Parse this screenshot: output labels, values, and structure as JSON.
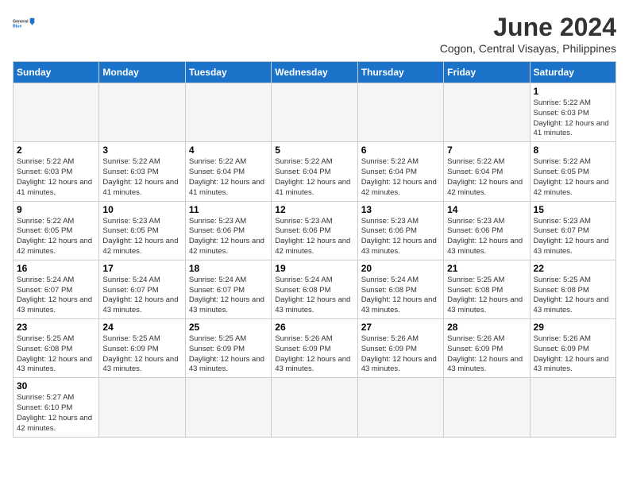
{
  "logo": {
    "text_general": "General",
    "text_blue": "Blue"
  },
  "header": {
    "month": "June 2024",
    "location": "Cogon, Central Visayas, Philippines"
  },
  "weekdays": [
    "Sunday",
    "Monday",
    "Tuesday",
    "Wednesday",
    "Thursday",
    "Friday",
    "Saturday"
  ],
  "days": [
    {
      "date": "",
      "sunrise": "",
      "sunset": "",
      "daylight": ""
    },
    {
      "date": "",
      "sunrise": "",
      "sunset": "",
      "daylight": ""
    },
    {
      "date": "",
      "sunrise": "",
      "sunset": "",
      "daylight": ""
    },
    {
      "date": "",
      "sunrise": "",
      "sunset": "",
      "daylight": ""
    },
    {
      "date": "",
      "sunrise": "",
      "sunset": "",
      "daylight": ""
    },
    {
      "date": "",
      "sunrise": "",
      "sunset": "",
      "daylight": ""
    },
    {
      "date": "1",
      "sunrise": "5:22 AM",
      "sunset": "6:03 PM",
      "daylight": "12 hours and 41 minutes."
    },
    {
      "date": "2",
      "sunrise": "5:22 AM",
      "sunset": "6:03 PM",
      "daylight": "12 hours and 41 minutes."
    },
    {
      "date": "3",
      "sunrise": "5:22 AM",
      "sunset": "6:03 PM",
      "daylight": "12 hours and 41 minutes."
    },
    {
      "date": "4",
      "sunrise": "5:22 AM",
      "sunset": "6:04 PM",
      "daylight": "12 hours and 41 minutes."
    },
    {
      "date": "5",
      "sunrise": "5:22 AM",
      "sunset": "6:04 PM",
      "daylight": "12 hours and 41 minutes."
    },
    {
      "date": "6",
      "sunrise": "5:22 AM",
      "sunset": "6:04 PM",
      "daylight": "12 hours and 42 minutes."
    },
    {
      "date": "7",
      "sunrise": "5:22 AM",
      "sunset": "6:04 PM",
      "daylight": "12 hours and 42 minutes."
    },
    {
      "date": "8",
      "sunrise": "5:22 AM",
      "sunset": "6:05 PM",
      "daylight": "12 hours and 42 minutes."
    },
    {
      "date": "9",
      "sunrise": "5:22 AM",
      "sunset": "6:05 PM",
      "daylight": "12 hours and 42 minutes."
    },
    {
      "date": "10",
      "sunrise": "5:23 AM",
      "sunset": "6:05 PM",
      "daylight": "12 hours and 42 minutes."
    },
    {
      "date": "11",
      "sunrise": "5:23 AM",
      "sunset": "6:06 PM",
      "daylight": "12 hours and 42 minutes."
    },
    {
      "date": "12",
      "sunrise": "5:23 AM",
      "sunset": "6:06 PM",
      "daylight": "12 hours and 42 minutes."
    },
    {
      "date": "13",
      "sunrise": "5:23 AM",
      "sunset": "6:06 PM",
      "daylight": "12 hours and 43 minutes."
    },
    {
      "date": "14",
      "sunrise": "5:23 AM",
      "sunset": "6:06 PM",
      "daylight": "12 hours and 43 minutes."
    },
    {
      "date": "15",
      "sunrise": "5:23 AM",
      "sunset": "6:07 PM",
      "daylight": "12 hours and 43 minutes."
    },
    {
      "date": "16",
      "sunrise": "5:24 AM",
      "sunset": "6:07 PM",
      "daylight": "12 hours and 43 minutes."
    },
    {
      "date": "17",
      "sunrise": "5:24 AM",
      "sunset": "6:07 PM",
      "daylight": "12 hours and 43 minutes."
    },
    {
      "date": "18",
      "sunrise": "5:24 AM",
      "sunset": "6:07 PM",
      "daylight": "12 hours and 43 minutes."
    },
    {
      "date": "19",
      "sunrise": "5:24 AM",
      "sunset": "6:08 PM",
      "daylight": "12 hours and 43 minutes."
    },
    {
      "date": "20",
      "sunrise": "5:24 AM",
      "sunset": "6:08 PM",
      "daylight": "12 hours and 43 minutes."
    },
    {
      "date": "21",
      "sunrise": "5:25 AM",
      "sunset": "6:08 PM",
      "daylight": "12 hours and 43 minutes."
    },
    {
      "date": "22",
      "sunrise": "5:25 AM",
      "sunset": "6:08 PM",
      "daylight": "12 hours and 43 minutes."
    },
    {
      "date": "23",
      "sunrise": "5:25 AM",
      "sunset": "6:08 PM",
      "daylight": "12 hours and 43 minutes."
    },
    {
      "date": "24",
      "sunrise": "5:25 AM",
      "sunset": "6:09 PM",
      "daylight": "12 hours and 43 minutes."
    },
    {
      "date": "25",
      "sunrise": "5:25 AM",
      "sunset": "6:09 PM",
      "daylight": "12 hours and 43 minutes."
    },
    {
      "date": "26",
      "sunrise": "5:26 AM",
      "sunset": "6:09 PM",
      "daylight": "12 hours and 43 minutes."
    },
    {
      "date": "27",
      "sunrise": "5:26 AM",
      "sunset": "6:09 PM",
      "daylight": "12 hours and 43 minutes."
    },
    {
      "date": "28",
      "sunrise": "5:26 AM",
      "sunset": "6:09 PM",
      "daylight": "12 hours and 43 minutes."
    },
    {
      "date": "29",
      "sunrise": "5:26 AM",
      "sunset": "6:09 PM",
      "daylight": "12 hours and 43 minutes."
    },
    {
      "date": "30",
      "sunrise": "5:27 AM",
      "sunset": "6:10 PM",
      "daylight": "12 hours and 42 minutes."
    }
  ]
}
